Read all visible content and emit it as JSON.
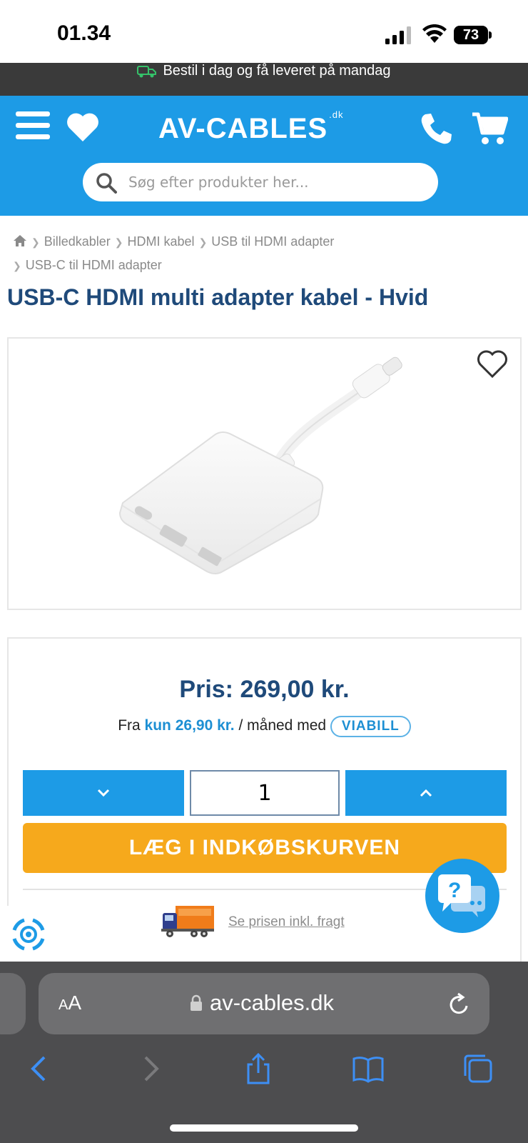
{
  "status": {
    "time": "01.34",
    "battery": "73"
  },
  "promo": {
    "text": "Bestil i dag og få leveret på mandag"
  },
  "header": {
    "logo": "AV-CABLES",
    "logo_suffix": ".dk",
    "search_placeholder": "Søg efter produkter her..."
  },
  "breadcrumb": {
    "items": [
      "Billedkabler",
      "HDMI kabel",
      "USB til HDMI adapter",
      "USB-C til HDMI adapter"
    ]
  },
  "product": {
    "title": "USB-C HDMI multi adapter kabel - Hvid"
  },
  "price": {
    "label": "Pris: 269,00 kr.",
    "finance_prefix": "Fra",
    "finance_amount": "kun 26,90 kr.",
    "finance_suffix": "/ måned med",
    "finance_brand": "VIABILL"
  },
  "cart": {
    "quantity": "1",
    "add_label": "LÆG I INDKØBSKURVEN",
    "freight_link": "Se prisen inkl. fragt"
  },
  "browser": {
    "aa_small": "A",
    "aa_large": "A",
    "url": "av-cables.dk"
  },
  "colors": {
    "brand_blue": "#1d9be6",
    "title_blue": "#1f4a7a",
    "cart_orange": "#f6a91c",
    "promo_bg": "#3a3a3a"
  }
}
